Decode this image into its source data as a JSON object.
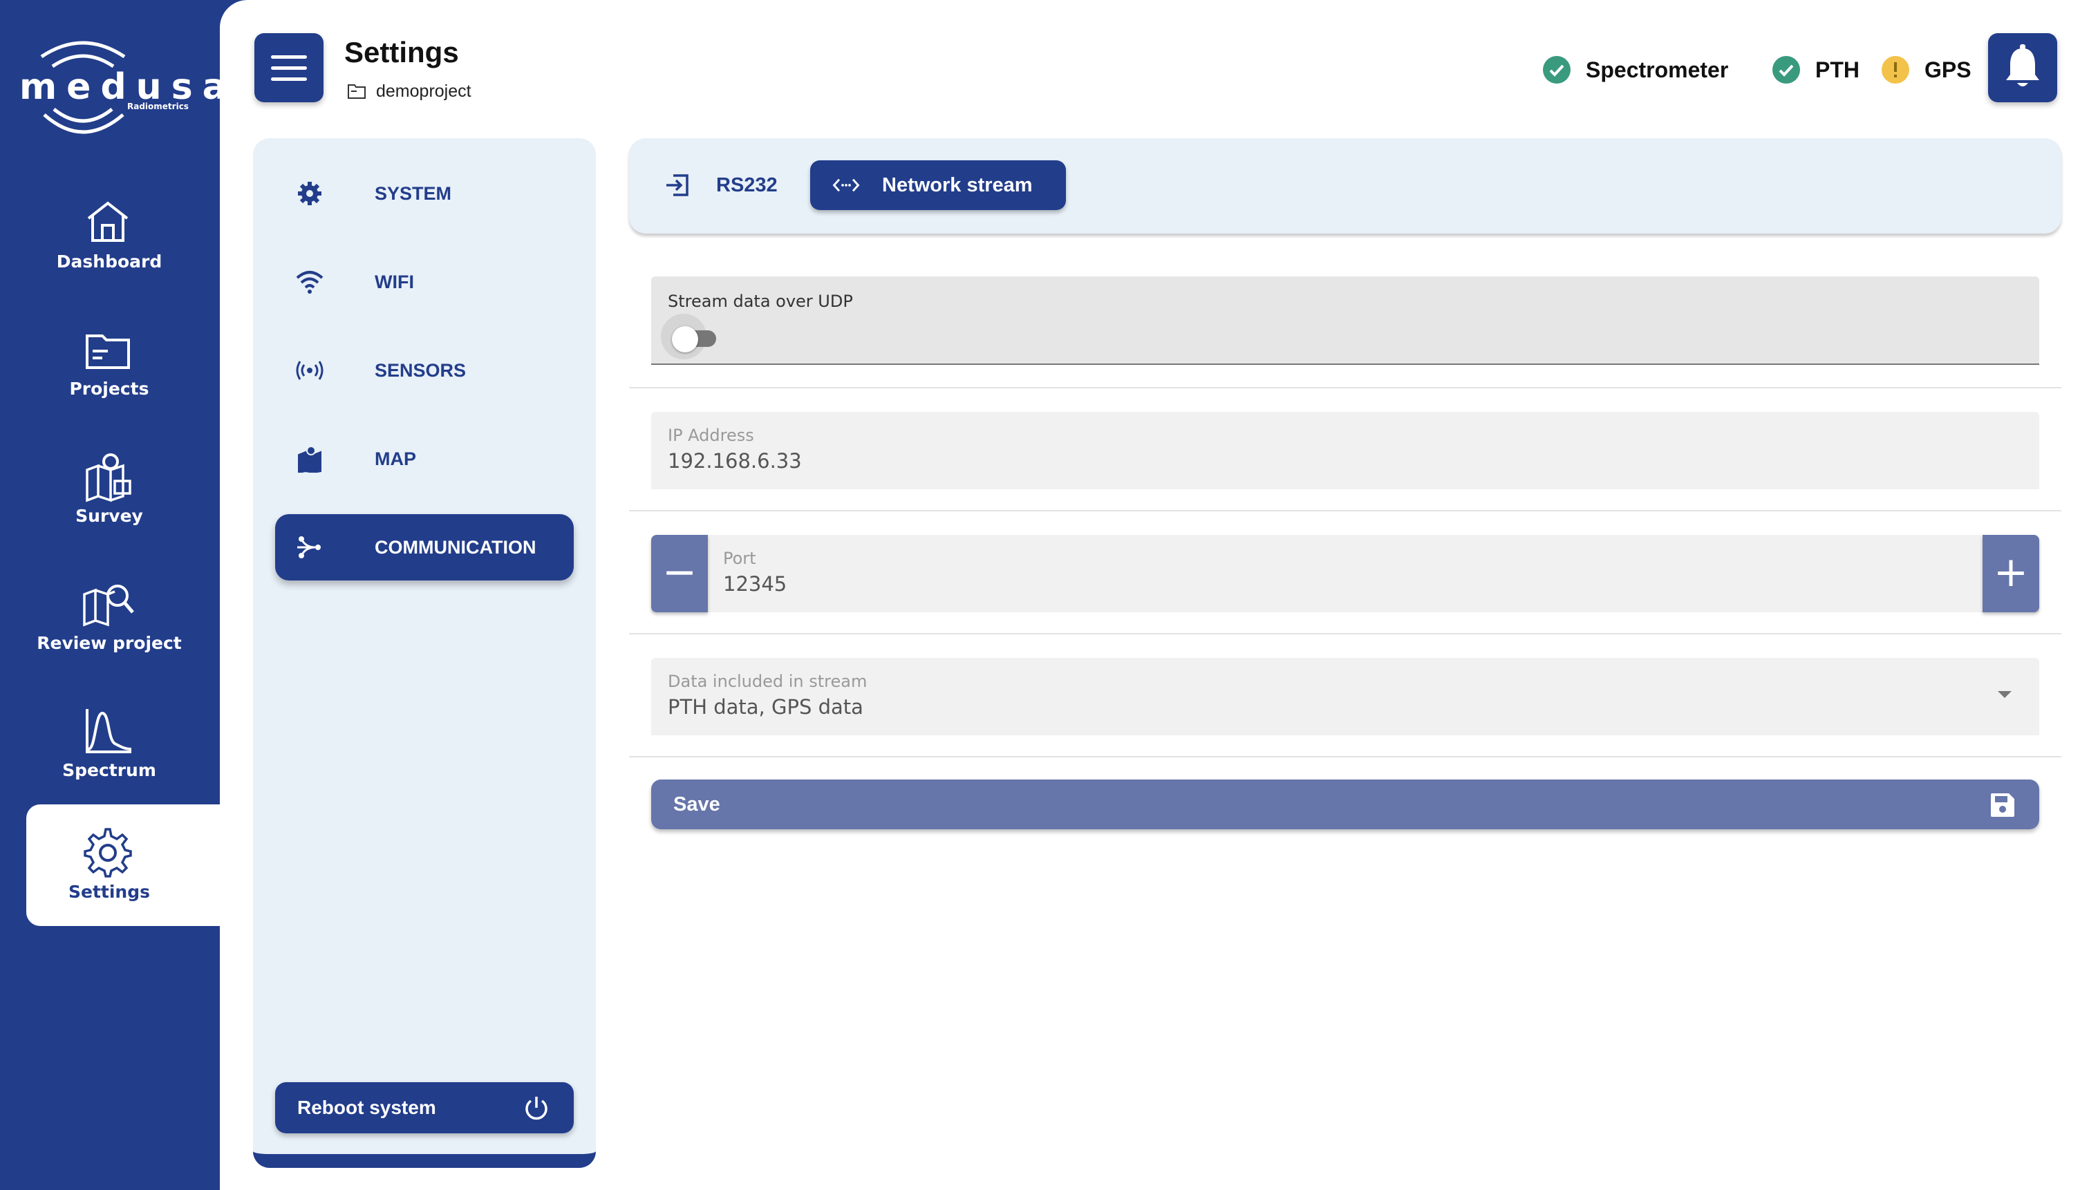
{
  "brand": {
    "name": "medusa",
    "sub": "Radiometrics"
  },
  "nav": [
    {
      "label": "Dashboard",
      "icon": "home-icon"
    },
    {
      "label": "Projects",
      "icon": "folder-icon"
    },
    {
      "label": "Survey",
      "icon": "map-pin-icon"
    },
    {
      "label": "Review project",
      "icon": "map-search-icon"
    },
    {
      "label": "Spectrum",
      "icon": "spectrum-chart-icon"
    },
    {
      "label": "Settings",
      "icon": "gear-icon",
      "active": true
    }
  ],
  "header": {
    "title": "Settings",
    "project": "demoproject",
    "status": [
      {
        "label": "Spectrometer",
        "state": "ok",
        "color": "#3a9a7e"
      },
      {
        "label": "PTH",
        "state": "ok",
        "color": "#3a9a7e"
      },
      {
        "label": "GPS",
        "state": "warning",
        "color": "#f2c24a"
      }
    ]
  },
  "settings_menu": {
    "items": [
      {
        "label": "SYSTEM",
        "icon": "gear-icon"
      },
      {
        "label": "WIFI",
        "icon": "wifi-icon"
      },
      {
        "label": "SENSORS",
        "icon": "sensor-icon"
      },
      {
        "label": "MAP",
        "icon": "map-icon"
      },
      {
        "label": "COMMUNICATION",
        "icon": "communication-icon",
        "active": true
      }
    ],
    "reboot_label": "Reboot system"
  },
  "comm_tabs": [
    {
      "label": "RS232",
      "icon": "import-icon"
    },
    {
      "label": "Network stream",
      "icon": "code-arrows-icon",
      "active": true
    }
  ],
  "form": {
    "udp": {
      "label": "Stream data over UDP",
      "enabled": false
    },
    "ip": {
      "label": "IP Address",
      "value": "192.168.6.33"
    },
    "port": {
      "label": "Port",
      "value": "12345",
      "minus": "−",
      "plus": "+"
    },
    "data": {
      "label": "Data included in stream",
      "value": "PTH data, GPS data"
    },
    "save_label": "Save"
  },
  "colors": {
    "primary": "#223d8a",
    "panel": "#e8f0f8",
    "button_muted": "#6675aa"
  }
}
